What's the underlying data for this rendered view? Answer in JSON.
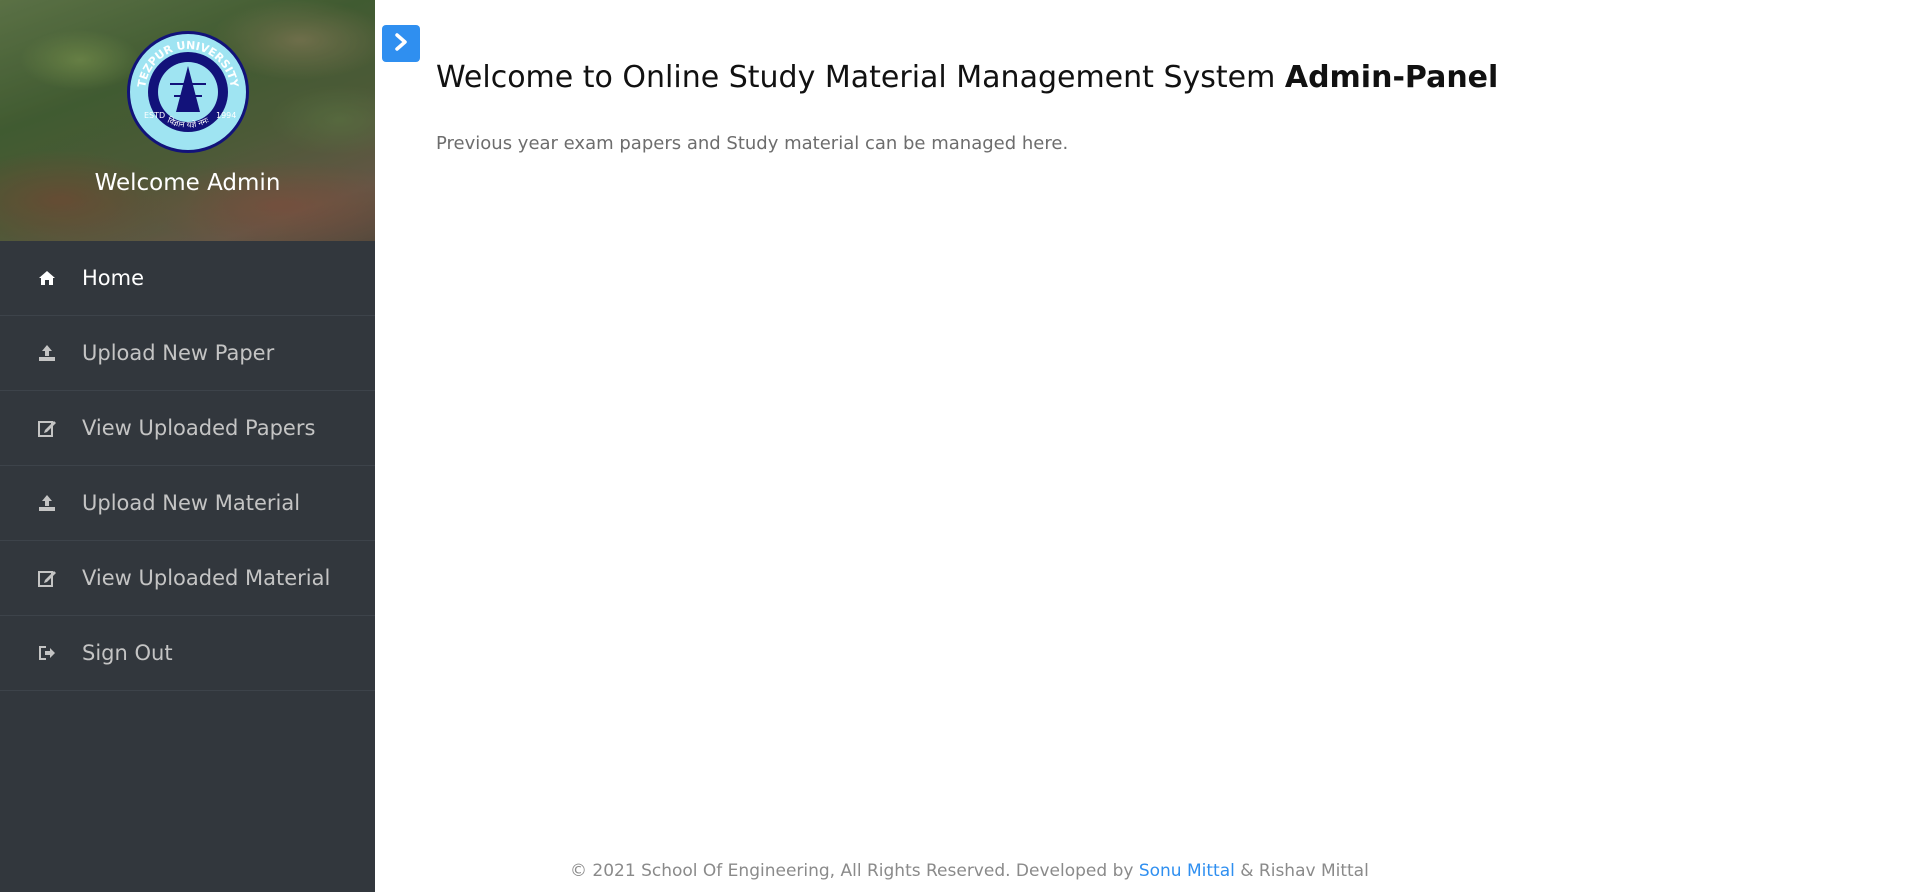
{
  "sidebar": {
    "logo": {
      "name": "tezpur-university-logo",
      "text_top": "TEZPUR UNIVERSITY",
      "text_left": "ESTD",
      "text_right": "1994",
      "text_bottom": "विज्ञान यज्ञे नमः"
    },
    "welcome_text": "Welcome Admin",
    "menu": [
      {
        "label": "Home",
        "icon": "home-icon",
        "active": true
      },
      {
        "label": "Upload New Paper",
        "icon": "upload-icon"
      },
      {
        "label": "View Uploaded Papers",
        "icon": "edit-icon"
      },
      {
        "label": "Upload New Material",
        "icon": "upload-icon"
      },
      {
        "label": "View Uploaded Material",
        "icon": "edit-icon"
      },
      {
        "label": "Sign Out",
        "icon": "sign-out-icon"
      }
    ]
  },
  "toggle": {
    "icon": "chevron-right-icon"
  },
  "main": {
    "title": "Welcome to Online Study Material Management System",
    "title_bold": "Admin-Panel",
    "subtitle": "Previous year exam papers and Study material can be managed here."
  },
  "footer": {
    "text_before": "© 2021 School Of Engineering, All Rights Reserved. Developed by",
    "link_text": "Sonu Mittal",
    "text_after": "& Rishav Mittal"
  },
  "colors": {
    "sidebar_bg": "#32373d",
    "accent": "#2f8ff0",
    "logo_blue": "#12127a",
    "logo_light": "#9fe4f2"
  }
}
